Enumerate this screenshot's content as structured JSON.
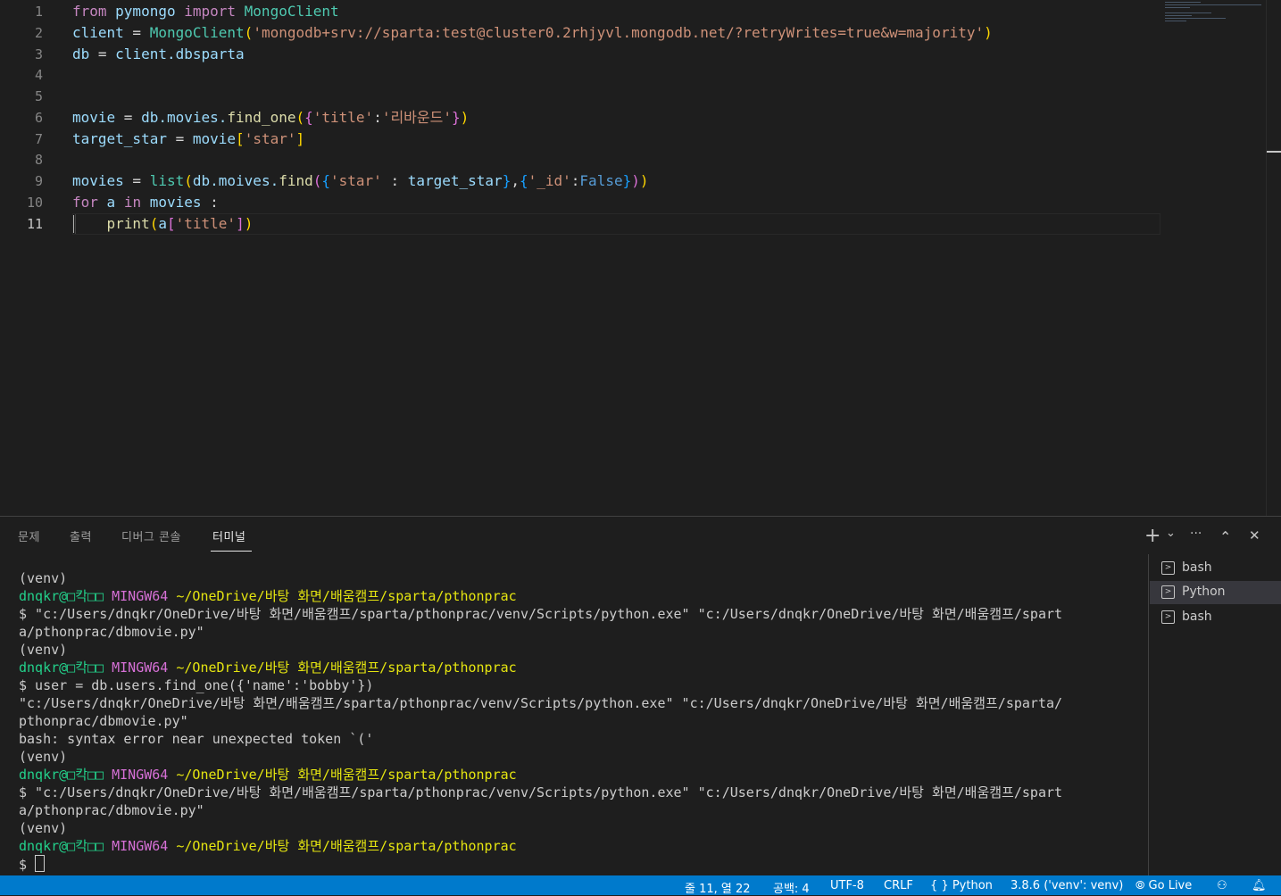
{
  "editor": {
    "line_numbers": [
      "1",
      "2",
      "3",
      "4",
      "5",
      "6",
      "7",
      "8",
      "9",
      "10",
      "11"
    ],
    "active_line": "11",
    "lines": {
      "l1": {
        "a": "from",
        "b": " pymongo ",
        "c": "import",
        "d": " MongoClient"
      },
      "l2": {
        "a": "client",
        "b": " = ",
        "c": "MongoClient",
        "d": "(",
        "e": "'mongodb+srv://sparta:test@cluster0.2rhjyvl.mongodb.net/?retryWrites=true&w=majority'",
        "f": ")"
      },
      "l3": {
        "a": "db",
        "b": " = ",
        "c": "client",
        "d": ".dbsparta"
      },
      "l6": {
        "a": "movie",
        "b": " = ",
        "c": "db",
        "d": ".movies.",
        "e": "find_one",
        "f": "(",
        "g": "{",
        "h": "'title'",
        "i": ":",
        "j": "'리바운드'",
        "k": "}",
        "l": ")"
      },
      "l7": {
        "a": "target_star",
        "b": " = ",
        "c": "movie",
        "d": "[",
        "e": "'star'",
        "f": "]"
      },
      "l9": {
        "a": "movies",
        "b": " = ",
        "c": "list",
        "d": "(",
        "e": "db",
        "f": ".moives.",
        "g": "find",
        "h": "(",
        "i": "{",
        "j": "'star'",
        "k": " : ",
        "l": "target_star",
        "m": "}",
        "n": ",",
        "o": "{",
        "p": "'_id'",
        "q": ":",
        "r": "False",
        "s": "}",
        "t": ")",
        "u": ")"
      },
      "l10": {
        "a": "for",
        "b": " ",
        "c": "a",
        "d": " ",
        "e": "in",
        "f": " ",
        "g": "movies",
        "h": " :"
      },
      "l11": {
        "a": "    ",
        "b": "print",
        "c": "(",
        "d": "a",
        "e": "[",
        "f": "'title'",
        "g": "]",
        "h": ")"
      }
    }
  },
  "panel": {
    "tabs": [
      {
        "label": "문제"
      },
      {
        "label": "출력"
      },
      {
        "label": "디버그 콘솔"
      },
      {
        "label": "터미널",
        "active": true
      }
    ],
    "actions": {
      "add": "+",
      "dropdown": "⌄",
      "more": "···",
      "maximize": "⌃",
      "close": "✕"
    }
  },
  "terminal": {
    "lines": [
      {
        "text": "(venv)"
      },
      {
        "user": "dnqkr@□칵□□",
        "host": " MINGW64 ",
        "path": "~/OneDrive/바탕 화면/배움캠프/sparta/pthonprac"
      },
      {
        "text": "$ \"c:/Users/dnqkr/OneDrive/바탕 화면/배움캠프/sparta/pthonprac/venv/Scripts/python.exe\" \"c:/Users/dnqkr/OneDrive/바탕 화면/배움캠프/spart"
      },
      {
        "text": "a/pthonprac/dbmovie.py\""
      },
      {
        "text": "(venv)"
      },
      {
        "user": "dnqkr@□칵□□",
        "host": " MINGW64 ",
        "path": "~/OneDrive/바탕 화면/배움캠프/sparta/pthonprac"
      },
      {
        "text": "$ user = db.users.find_one({'name':'bobby'})"
      },
      {
        "text": "\"c:/Users/dnqkr/OneDrive/바탕 화면/배움캠프/sparta/pthonprac/venv/Scripts/python.exe\" \"c:/Users/dnqkr/OneDrive/바탕 화면/배움캠프/sparta/"
      },
      {
        "text": "pthonprac/dbmovie.py\""
      },
      {
        "text": "bash: syntax error near unexpected token `('"
      },
      {
        "text": "(venv)"
      },
      {
        "user": "dnqkr@□칵□□",
        "host": " MINGW64 ",
        "path": "~/OneDrive/바탕 화면/배움캠프/sparta/pthonprac"
      },
      {
        "text": "$ \"c:/Users/dnqkr/OneDrive/바탕 화면/배움캠프/sparta/pthonprac/venv/Scripts/python.exe\" \"c:/Users/dnqkr/OneDrive/바탕 화면/배움캠프/spart"
      },
      {
        "text": "a/pthonprac/dbmovie.py\""
      },
      {
        "text": "(venv)"
      },
      {
        "user": "dnqkr@□칵□□",
        "host": " MINGW64 ",
        "path": "~/OneDrive/바탕 화면/배움캠프/sparta/pthonprac"
      }
    ],
    "prompt": "$ ",
    "list": [
      {
        "label": "bash",
        "selected": false
      },
      {
        "label": "Python",
        "selected": true
      },
      {
        "label": "bash",
        "selected": false
      }
    ]
  },
  "status": {
    "position": "줄 11, 열 22",
    "indent": "공백: 4",
    "encoding": "UTF-8",
    "eol": "CRLF",
    "language": "Python",
    "interpreter": "3.8.6 ('venv': venv)",
    "golive": "Go Live"
  },
  "colors": {
    "statusbar": "#007acc",
    "editor_bg": "#1e1e1e",
    "keyword": "#c586c0",
    "string": "#ce9178",
    "function": "#dcdcaa",
    "class": "#4ec9b0",
    "variable": "#9cdcfe"
  }
}
